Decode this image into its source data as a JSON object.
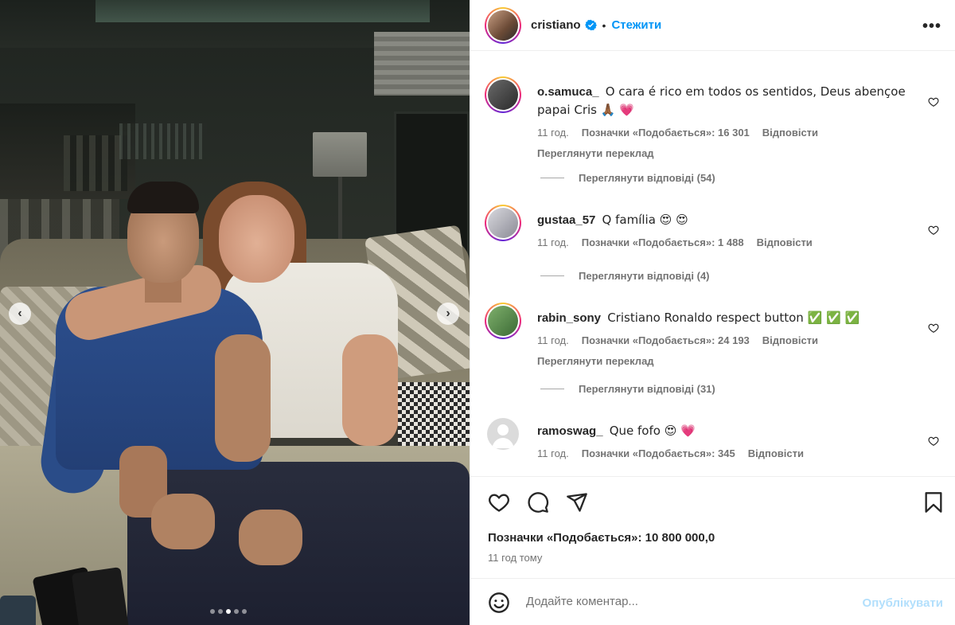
{
  "post": {
    "author": "cristiano",
    "follow_label": "Стежити",
    "separator": "•",
    "more_label": "•••"
  },
  "carousel": {
    "prev_label": "‹",
    "next_label": "›",
    "slide_count": 5,
    "active_index": 2
  },
  "comments": [
    {
      "user": "o.samuca_",
      "text": "O cara é rico em todos os sentidos, Deus abençoe papai Cris 🙏🏾 💗",
      "time": "11 год.",
      "likes": "Позначки «Подобається»: 16 301",
      "reply": "Відповісти",
      "translate": "Переглянути переклад",
      "view_replies": "Переглянути відповіді (54)"
    },
    {
      "user": "gustaa_57",
      "text": "Q família 😍 😍",
      "time": "11 год.",
      "likes": "Позначки «Подобається»: 1 488",
      "reply": "Відповісти",
      "view_replies": "Переглянути відповіді (4)"
    },
    {
      "user": "rabin_sony",
      "text": "Cristiano Ronaldo respect button ✅ ✅ ✅",
      "time": "11 год.",
      "likes": "Позначки «Подобається»: 24 193",
      "reply": "Відповісти",
      "translate": "Переглянути переклад",
      "view_replies": "Переглянути відповіді (31)"
    },
    {
      "user": "ramoswag_",
      "text": "Que fofo 😍 💗",
      "time": "11 год.",
      "likes": "Позначки «Подобається»: 345",
      "reply": "Відповісти"
    }
  ],
  "stats": {
    "likes_total": "Позначки «Подобається»: 10 800 000,0",
    "time_ago": "11 год тому"
  },
  "comment_box": {
    "placeholder": "Додайте коментар...",
    "publish_label": "Опублікувати"
  },
  "colors": {
    "accent": "#0095f6",
    "publish_disabled": "#b2dffc",
    "secondary_text": "#737373"
  }
}
